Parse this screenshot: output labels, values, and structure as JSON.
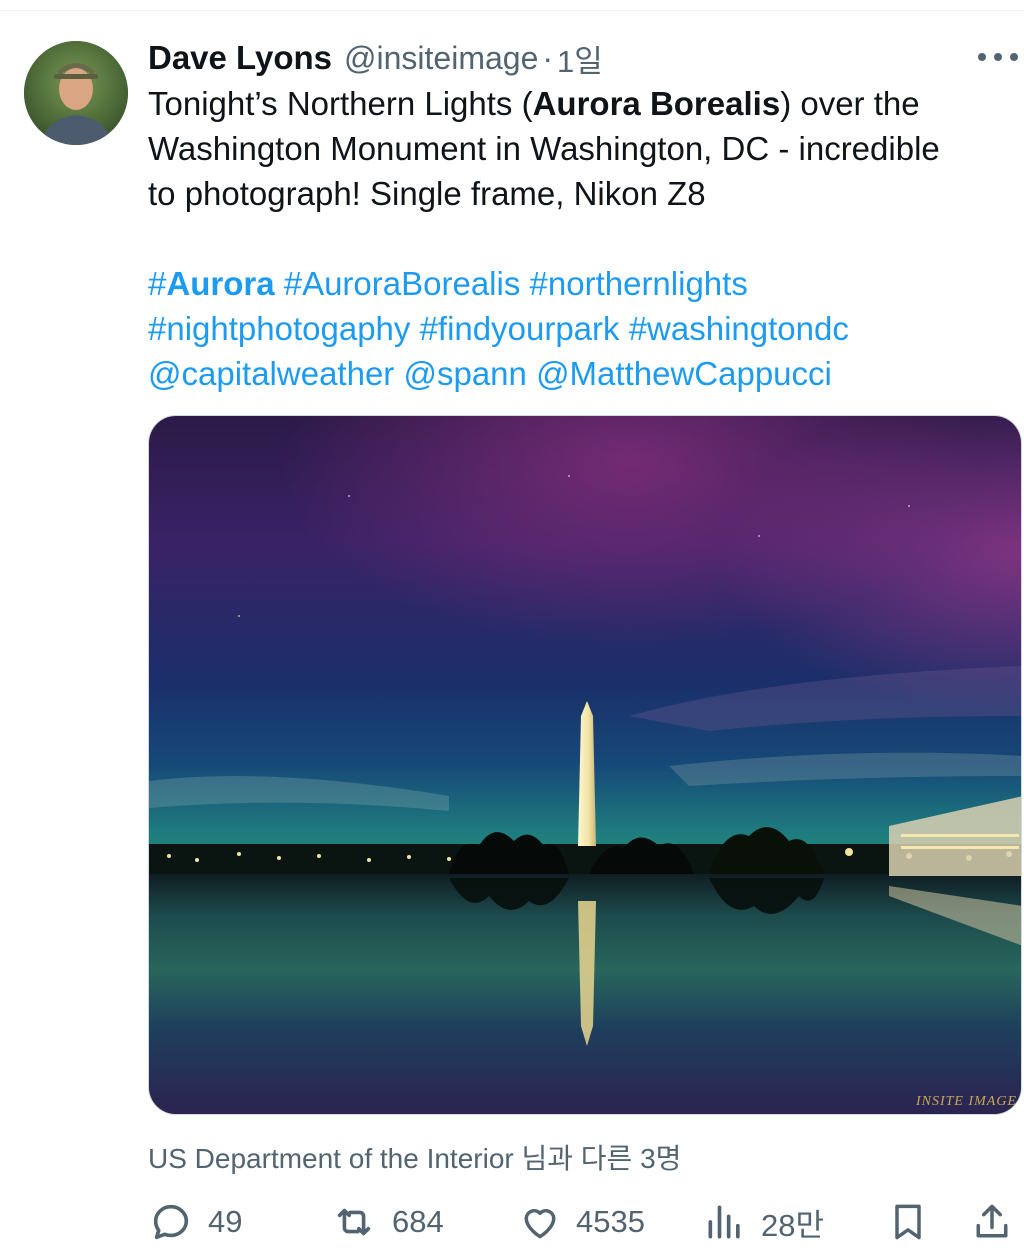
{
  "tweet": {
    "author_name": "Dave Lyons",
    "handle": "@insiteimage",
    "separator": "·",
    "time": "1일",
    "text_line1_a": "Tonight’s Northern Lights (",
    "text_line1_b": "Aurora Borealis",
    "text_line1_c": ") over the",
    "text_line2": "Washington Monument in Washington, DC - incredible",
    "text_line3": "to photograph! Single frame, Nikon Z8",
    "tags": {
      "aurora_hash": "#",
      "aurora_word": "Aurora",
      "aurora_borealis": "#AuroraBorealis",
      "northernlights": "#northernlights",
      "nightphotogaphy": "#nightphotogaphy",
      "findyourpark": "#findyourpark",
      "washingtondc": "#washingtondc",
      "capitalweather": "@capitalweather",
      "spann": "@spann",
      "matthewcappucci": "@MatthewCappucci"
    },
    "watermark": "INSITE IMAGE",
    "likes_by": "US Department of the Interior 님과 다른 3명"
  },
  "actions": {
    "replies": "49",
    "reposts": "684",
    "likes": "4535",
    "views": "28만"
  },
  "icons": {
    "more": "more-icon",
    "reply": "reply-icon",
    "repost": "repost-icon",
    "like": "like-icon",
    "views": "views-icon",
    "bookmark": "bookmark-icon",
    "share": "share-icon"
  },
  "colors": {
    "text": "#0f1419",
    "secondary": "#536471",
    "link": "#1d9bf0"
  }
}
